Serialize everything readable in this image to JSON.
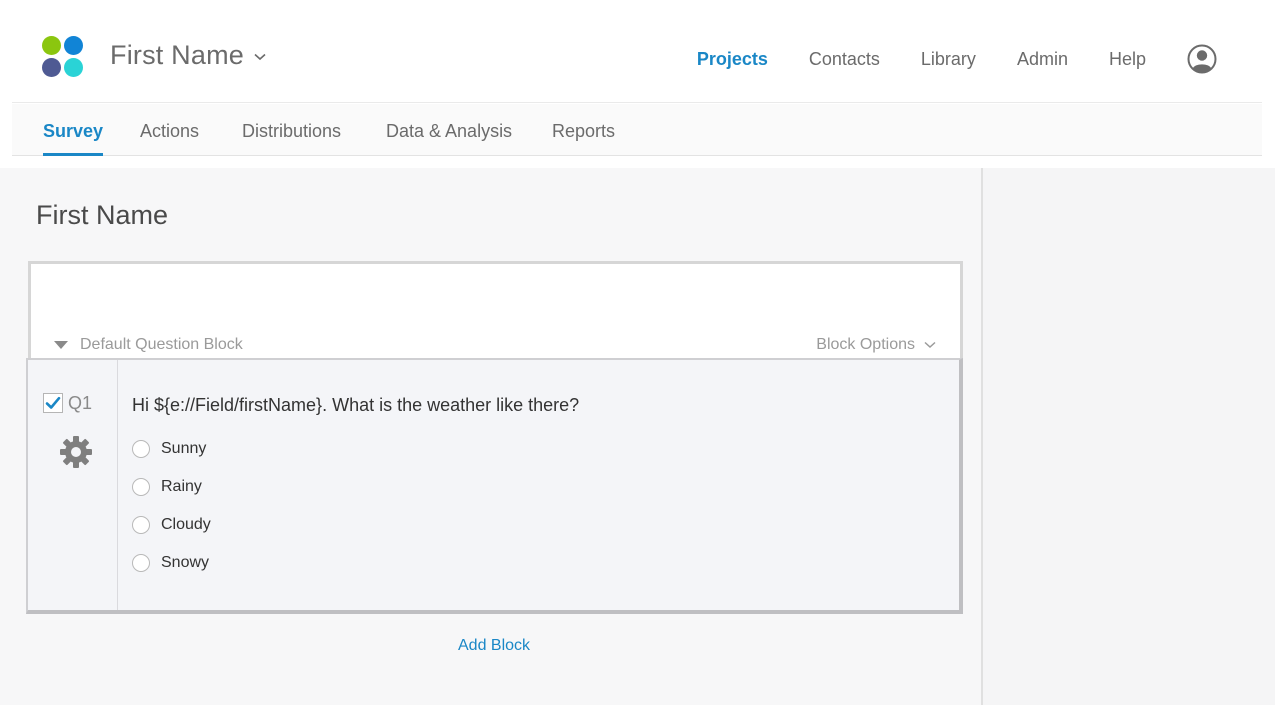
{
  "header": {
    "project_name": "First Name",
    "nav": [
      "Projects",
      "Contacts",
      "Library",
      "Admin",
      "Help"
    ],
    "active_nav": "Projects",
    "user_icon": "user-avatar-icon"
  },
  "subtabs": {
    "items": [
      "Survey",
      "Actions",
      "Distributions",
      "Data & Analysis",
      "Reports"
    ],
    "active": "Survey"
  },
  "survey": {
    "title": "First Name",
    "block": {
      "name": "Default Question Block",
      "options_label": "Block Options"
    },
    "question": {
      "number": "Q1",
      "checked": true,
      "text": "Hi ${e://Field/firstName}. What is the weather like there?",
      "choices": [
        "Sunny",
        "Rainy",
        "Cloudy",
        "Snowy"
      ]
    },
    "add_block_label": "Add Block"
  },
  "colors": {
    "accent": "#1a87c6",
    "logo": [
      "#8bc60f",
      "#1184d6",
      "#4f5a93",
      "#2ad3d6"
    ]
  }
}
